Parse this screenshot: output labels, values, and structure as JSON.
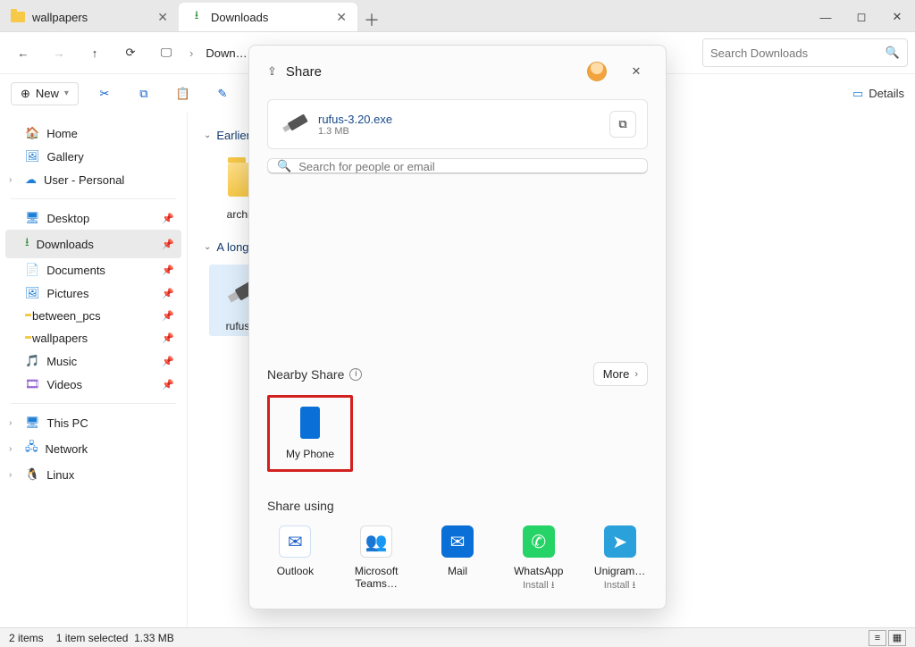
{
  "tabs": [
    {
      "label": "wallpapers",
      "icon": "folder"
    },
    {
      "label": "Downloads",
      "icon": "download"
    }
  ],
  "active_tab": 1,
  "breadcrumb": "Down…",
  "search_placeholder": "Search Downloads",
  "cmdbar": {
    "new_label": "New",
    "details_label": "Details"
  },
  "sidebar": {
    "top": [
      {
        "label": "Home",
        "icon": "home"
      },
      {
        "label": "Gallery",
        "icon": "gallery"
      },
      {
        "label": "User - Personal",
        "icon": "onedrive",
        "expandable": true
      }
    ],
    "quick": [
      {
        "label": "Desktop",
        "pin": true
      },
      {
        "label": "Downloads",
        "pin": true,
        "active": true
      },
      {
        "label": "Documents",
        "pin": true
      },
      {
        "label": "Pictures",
        "pin": true
      },
      {
        "label": "between_pcs",
        "pin": true
      },
      {
        "label": "wallpapers",
        "pin": true
      },
      {
        "label": "Music",
        "pin": true
      },
      {
        "label": "Videos",
        "pin": true
      }
    ],
    "bottom": [
      {
        "label": "This PC",
        "expandable": true
      },
      {
        "label": "Network",
        "expandable": true
      },
      {
        "label": "Linux",
        "expandable": true
      }
    ]
  },
  "groups": [
    {
      "heading": "Earlier t…",
      "items": [
        {
          "label": "archiva…",
          "kind": "folder"
        }
      ]
    },
    {
      "heading": "A long t…",
      "items": [
        {
          "label": "rufus-3.…",
          "kind": "exe",
          "selected": true
        }
      ]
    }
  ],
  "status": {
    "count": "2 items",
    "selection": "1 item selected",
    "size": "1.33 MB"
  },
  "share": {
    "title": "Share",
    "file": {
      "name": "rufus-3.20.exe",
      "size": "1.3 MB"
    },
    "search_placeholder": "Search for people or email",
    "nearby_label": "Nearby Share",
    "more_label": "More",
    "device": "My Phone",
    "share_using_label": "Share using",
    "apps": [
      {
        "name": "Outlook",
        "color": "#fff",
        "fg": "#1e62c9",
        "glyph": "✉"
      },
      {
        "name": "Microsoft Teams…",
        "color": "#fff",
        "fg": "#5558af",
        "glyph": "👥"
      },
      {
        "name": "Mail",
        "color": "#0a6fd6",
        "fg": "#fff",
        "glyph": "✉"
      },
      {
        "name": "WhatsApp",
        "sub": "Install ⭳",
        "color": "#25d366",
        "fg": "#fff",
        "glyph": "✆"
      },
      {
        "name": "Unigram…",
        "sub": "Install ⭳",
        "color": "#2aa1db",
        "fg": "#fff",
        "glyph": "➤"
      }
    ]
  }
}
